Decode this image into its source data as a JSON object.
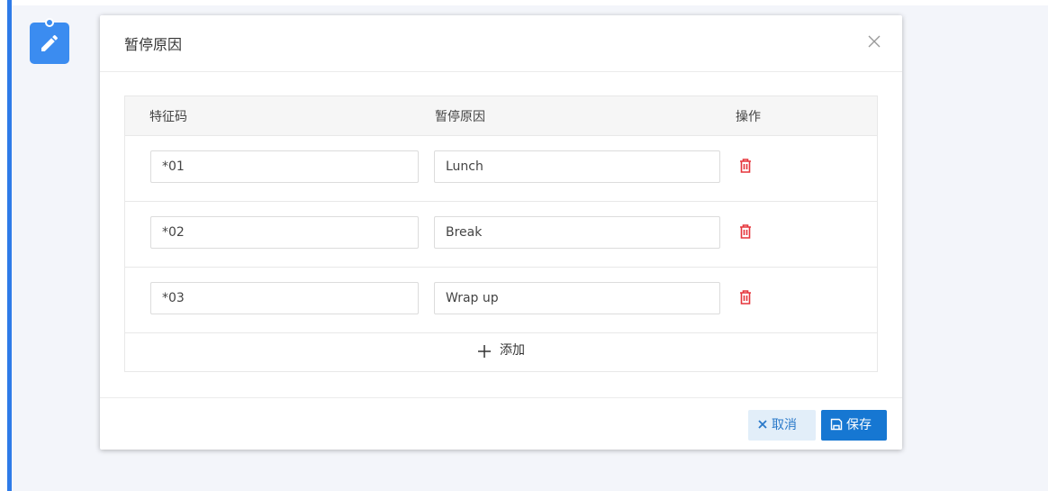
{
  "dialog": {
    "title": "暂停原因",
    "columns": {
      "code": "特征码",
      "reason": "暂停原因",
      "operation": "操作"
    },
    "rows": [
      {
        "code": "*01",
        "reason": "Lunch"
      },
      {
        "code": "*02",
        "reason": "Break"
      },
      {
        "code": "*03",
        "reason": "Wrap up"
      }
    ],
    "add_label": "添加",
    "cancel_label": "取消",
    "save_label": "保存"
  },
  "colors": {
    "accent": "#2e7be8",
    "delete_icon": "#e5353b",
    "save_button": "#1677d2",
    "cancel_button_bg": "#e2eef9"
  },
  "icons": {
    "page_badge": "edit-icon",
    "close": "close-icon",
    "delete": "trash-icon",
    "add": "plus-icon",
    "cancel": "close-icon",
    "save": "save-icon"
  }
}
